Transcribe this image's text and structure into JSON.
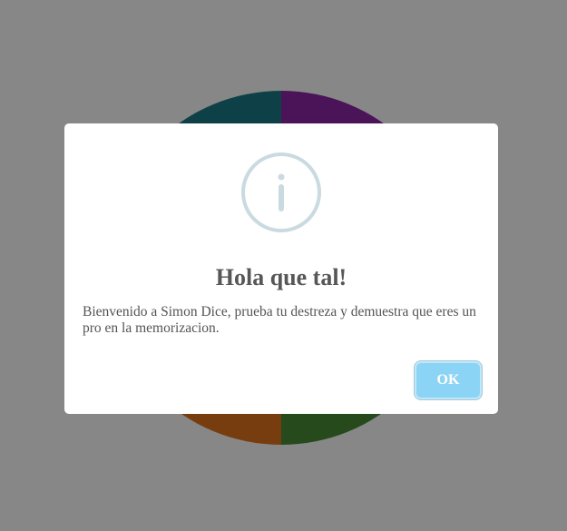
{
  "board": {
    "colors": {
      "top_left": "#1b7c86",
      "top_right": "#8e24a7",
      "bottom_left": "#e2741d",
      "bottom_right": "#4b8d38"
    }
  },
  "overlay": {
    "color": "#000000"
  },
  "dialog": {
    "icon": "info-icon",
    "icon_color": "#c9dae1",
    "title": "Hola que tal!",
    "text": "Bienvenido a Simon Dice, prueba tu destreza y demuestra que eres un pro en la memorizacion.",
    "ok_label": "OK",
    "ok_color": "#8CD4F5"
  }
}
